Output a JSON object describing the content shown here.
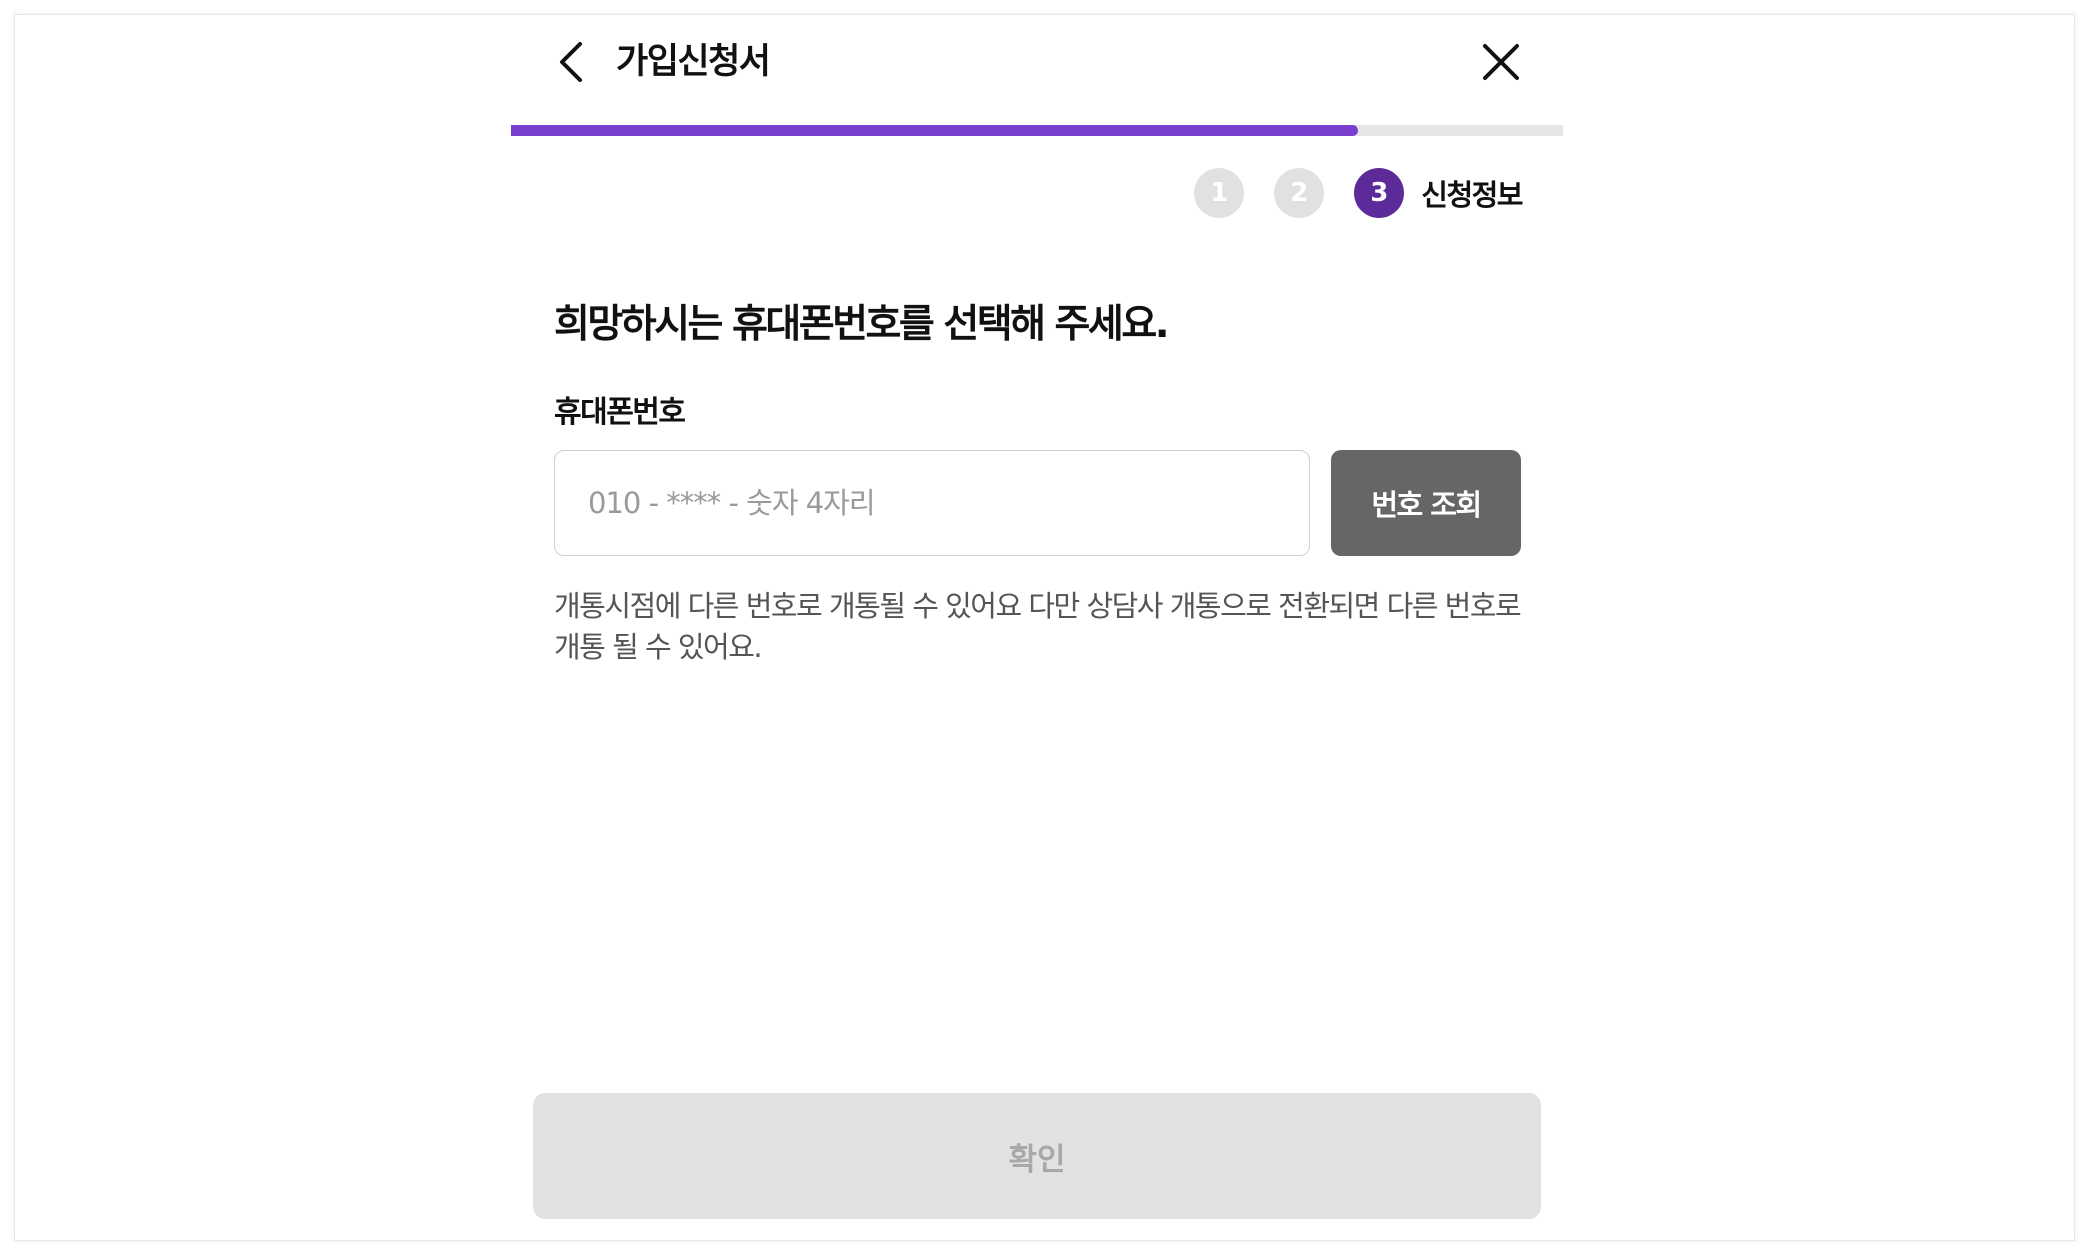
{
  "header": {
    "title": "가입신청서",
    "back_icon": "chevron-left-icon",
    "close_icon": "close-icon"
  },
  "progress": {
    "fraction": 0.805,
    "color": "#7b3fd0",
    "track_color": "#e5e5e5"
  },
  "steps": {
    "items": [
      "1",
      "2",
      "3"
    ],
    "current_index": 2,
    "current_label": "신청정보",
    "active_color": "#5d2a99"
  },
  "main": {
    "heading": "희망하시는 휴대폰번호를 선택해 주세요.",
    "field_label": "휴대폰번호",
    "phone_input": {
      "value": "",
      "placeholder": "010 - **** - 숫자 4자리"
    },
    "lookup_button_label": "번호 조회",
    "help_text": "개통시점에 다른 번호로 개통될 수 있어요 다만 상담사 개통으로 전환되면 다른 번호로 개통 될 수 있어요."
  },
  "footer": {
    "confirm_label": "확인"
  }
}
